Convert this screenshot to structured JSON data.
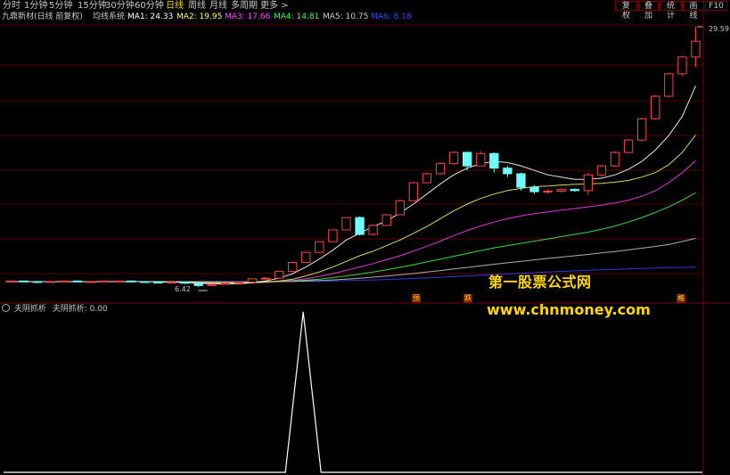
{
  "tabs": [
    "分时",
    "1分钟",
    "5分钟",
    "15分钟",
    "30分钟",
    "60分钟",
    "日线",
    "周线",
    "月线",
    "多周期",
    "更多 >"
  ],
  "active_tab": "日线",
  "toolbar_buttons": [
    "复权",
    "叠加",
    "统计",
    "画线",
    "F10"
  ],
  "legend": {
    "stock": "九鼎新材(日线 前复权)",
    "indicator": "均线系统",
    "ma1": "MA1: 24.33",
    "ma2": "MA2: 19.95",
    "ma3": "MA3: 17.66",
    "ma4": "MA4: 14.81",
    "ma5": "MA5: 10.75",
    "ma6": "MA6: 8.18"
  },
  "colors": {
    "ma1": "#ffffff",
    "ma2": "#ffff66",
    "ma3": "#ff44ff",
    "ma4": "#44ff44",
    "ma5": "#cccccc",
    "ma6": "#3344ff",
    "up": "#ff4444",
    "down": "#6fffff"
  },
  "price_max_label": "29.59",
  "price_min_label": "6.42",
  "markers": [
    "预",
    "跌",
    "格"
  ],
  "watermark": {
    "line1": "第一股票公式网",
    "line2": "www.chnmoney.com"
  },
  "indicator_legend": {
    "name": "夫阴抓析",
    "value_label": "夫阴抓析: 0.00"
  },
  "chart_data": {
    "type": "candlestick",
    "ohlc": [
      [
        6.9,
        7.0,
        6.8,
        6.95
      ],
      [
        6.95,
        7.0,
        6.85,
        6.9
      ],
      [
        6.9,
        6.95,
        6.8,
        6.85
      ],
      [
        6.85,
        6.95,
        6.8,
        6.9
      ],
      [
        6.9,
        7.0,
        6.85,
        6.95
      ],
      [
        6.95,
        7.0,
        6.85,
        6.9
      ],
      [
        6.9,
        6.95,
        6.85,
        6.9
      ],
      [
        6.9,
        7.0,
        6.85,
        6.95
      ],
      [
        6.95,
        7.0,
        6.9,
        6.95
      ],
      [
        6.95,
        7.0,
        6.85,
        6.9
      ],
      [
        6.9,
        6.95,
        6.8,
        6.85
      ],
      [
        6.85,
        6.9,
        6.75,
        6.8
      ],
      [
        6.8,
        6.9,
        6.75,
        6.85
      ],
      [
        6.85,
        6.9,
        6.7,
        6.75
      ],
      [
        6.75,
        6.85,
        6.42,
        6.55
      ],
      [
        6.55,
        6.7,
        6.5,
        6.65
      ],
      [
        6.65,
        6.8,
        6.6,
        6.75
      ],
      [
        6.75,
        6.9,
        6.7,
        6.85
      ],
      [
        6.85,
        7.2,
        6.8,
        7.15
      ],
      [
        7.15,
        7.3,
        7.1,
        7.2
      ],
      [
        7.2,
        7.8,
        7.2,
        7.8
      ],
      [
        7.8,
        8.6,
        7.8,
        8.6
      ],
      [
        8.6,
        9.5,
        8.6,
        9.5
      ],
      [
        9.5,
        10.5,
        9.5,
        10.45
      ],
      [
        10.45,
        11.5,
        10.45,
        11.5
      ],
      [
        11.5,
        12.6,
        11.5,
        12.6
      ],
      [
        12.6,
        12.7,
        11.0,
        11.1
      ],
      [
        11.1,
        12.0,
        11.0,
        11.9
      ],
      [
        11.9,
        12.9,
        11.9,
        12.85
      ],
      [
        12.85,
        14.2,
        12.85,
        14.1
      ],
      [
        14.1,
        15.8,
        14.1,
        15.7
      ],
      [
        15.7,
        16.6,
        15.7,
        16.5
      ],
      [
        16.5,
        17.5,
        16.4,
        17.4
      ],
      [
        17.4,
        18.5,
        17.3,
        18.4
      ],
      [
        18.4,
        18.5,
        16.8,
        17.2
      ],
      [
        17.2,
        18.5,
        17.2,
        18.3
      ],
      [
        18.3,
        18.4,
        16.6,
        17.0
      ],
      [
        17.0,
        17.2,
        16.2,
        16.5
      ],
      [
        16.5,
        16.6,
        15.0,
        15.3
      ],
      [
        15.3,
        15.5,
        14.7,
        14.9
      ],
      [
        14.9,
        15.1,
        14.7,
        14.95
      ],
      [
        14.95,
        15.2,
        14.8,
        15.1
      ],
      [
        15.1,
        15.2,
        14.9,
        15.0
      ],
      [
        15.0,
        16.6,
        14.6,
        16.4
      ],
      [
        16.4,
        17.3,
        16.2,
        17.2
      ],
      [
        17.2,
        18.5,
        17.1,
        18.4
      ],
      [
        18.4,
        19.6,
        18.3,
        19.5
      ],
      [
        19.5,
        21.5,
        19.4,
        21.4
      ],
      [
        21.4,
        23.5,
        21.3,
        23.4
      ],
      [
        23.4,
        25.5,
        23.3,
        25.4
      ],
      [
        25.4,
        27.0,
        25.2,
        26.9
      ],
      [
        26.9,
        29.59,
        26.0,
        28.3
      ]
    ],
    "ma": {
      "ma1": [
        6.9,
        6.9,
        6.9,
        6.9,
        6.9,
        6.9,
        6.9,
        6.9,
        6.9,
        6.9,
        6.9,
        6.88,
        6.85,
        6.82,
        6.75,
        6.7,
        6.68,
        6.7,
        6.8,
        6.95,
        7.2,
        7.6,
        8.2,
        8.9,
        9.7,
        10.6,
        11.2,
        11.8,
        12.3,
        13.0,
        13.8,
        14.7,
        15.6,
        16.4,
        17.0,
        17.4,
        17.6,
        17.5,
        17.2,
        16.8,
        16.4,
        16.2,
        16.0,
        16.0,
        16.1,
        16.4,
        16.9,
        17.6,
        18.6,
        19.9,
        21.6,
        24.33
      ],
      "ma2": [
        6.9,
        6.9,
        6.9,
        6.9,
        6.9,
        6.9,
        6.9,
        6.9,
        6.9,
        6.9,
        6.9,
        6.9,
        6.88,
        6.86,
        6.82,
        6.78,
        6.76,
        6.76,
        6.8,
        6.85,
        6.95,
        7.1,
        7.4,
        7.75,
        8.2,
        8.7,
        9.2,
        9.6,
        10.1,
        10.6,
        11.2,
        11.8,
        12.5,
        13.2,
        13.8,
        14.3,
        14.7,
        15.0,
        15.2,
        15.35,
        15.4,
        15.5,
        15.55,
        15.6,
        15.65,
        15.75,
        15.9,
        16.2,
        16.6,
        17.3,
        18.4,
        19.95
      ],
      "ma3": [
        6.9,
        6.9,
        6.9,
        6.9,
        6.9,
        6.9,
        6.9,
        6.9,
        6.9,
        6.9,
        6.9,
        6.9,
        6.9,
        6.88,
        6.86,
        6.84,
        6.82,
        6.82,
        6.83,
        6.86,
        6.92,
        7.0,
        7.15,
        7.35,
        7.6,
        7.9,
        8.2,
        8.5,
        8.85,
        9.2,
        9.6,
        10.05,
        10.5,
        11.0,
        11.45,
        11.85,
        12.2,
        12.5,
        12.75,
        12.95,
        13.1,
        13.25,
        13.4,
        13.55,
        13.7,
        13.9,
        14.15,
        14.5,
        15.0,
        15.7,
        16.6,
        17.66
      ],
      "ma4": [
        6.9,
        6.9,
        6.9,
        6.9,
        6.9,
        6.9,
        6.9,
        6.9,
        6.9,
        6.9,
        6.9,
        6.9,
        6.9,
        6.9,
        6.88,
        6.87,
        6.86,
        6.86,
        6.87,
        6.88,
        6.9,
        6.95,
        7.02,
        7.12,
        7.25,
        7.4,
        7.57,
        7.75,
        7.95,
        8.17,
        8.4,
        8.65,
        8.9,
        9.15,
        9.4,
        9.65,
        9.9,
        10.1,
        10.3,
        10.5,
        10.7,
        10.9,
        11.1,
        11.3,
        11.55,
        11.85,
        12.2,
        12.6,
        13.05,
        13.55,
        14.15,
        14.81
      ],
      "ma5": [
        6.9,
        6.9,
        6.9,
        6.9,
        6.9,
        6.9,
        6.9,
        6.9,
        6.9,
        6.9,
        6.9,
        6.9,
        6.9,
        6.9,
        6.9,
        6.89,
        6.88,
        6.88,
        6.88,
        6.89,
        6.9,
        6.92,
        6.95,
        6.99,
        7.05,
        7.12,
        7.2,
        7.29,
        7.39,
        7.5,
        7.62,
        7.75,
        7.88,
        8.02,
        8.16,
        8.3,
        8.44,
        8.57,
        8.7,
        8.83,
        8.96,
        9.08,
        9.2,
        9.32,
        9.45,
        9.58,
        9.72,
        9.87,
        10.03,
        10.2,
        10.47,
        10.75
      ],
      "ma6": [
        6.9,
        6.9,
        6.9,
        6.9,
        6.9,
        6.9,
        6.9,
        6.9,
        6.9,
        6.9,
        6.9,
        6.9,
        6.9,
        6.9,
        6.9,
        6.9,
        6.9,
        6.9,
        6.9,
        6.9,
        6.9,
        6.91,
        6.92,
        6.94,
        6.96,
        6.99,
        7.02,
        7.05,
        7.09,
        7.13,
        7.18,
        7.23,
        7.28,
        7.34,
        7.4,
        7.46,
        7.52,
        7.58,
        7.64,
        7.7,
        7.76,
        7.81,
        7.86,
        7.9,
        7.94,
        7.98,
        8.02,
        8.06,
        8.1,
        8.13,
        8.16,
        8.18
      ]
    },
    "price_range": [
      6.42,
      29.59
    ],
    "indicator": {
      "values": [
        0,
        0,
        0,
        0,
        0,
        0,
        0,
        0,
        0,
        0,
        0,
        0,
        0,
        0,
        0,
        0,
        0,
        0,
        0,
        0,
        0,
        0,
        0,
        0,
        0,
        0,
        0,
        0,
        0,
        0,
        0,
        0,
        0,
        0,
        0,
        0,
        0,
        0,
        0,
        0,
        0,
        0,
        0,
        0,
        0,
        0,
        0,
        0,
        0,
        0,
        0,
        0
      ],
      "peak_index": 21,
      "peak_value": 1,
      "range": [
        0,
        1
      ]
    }
  }
}
